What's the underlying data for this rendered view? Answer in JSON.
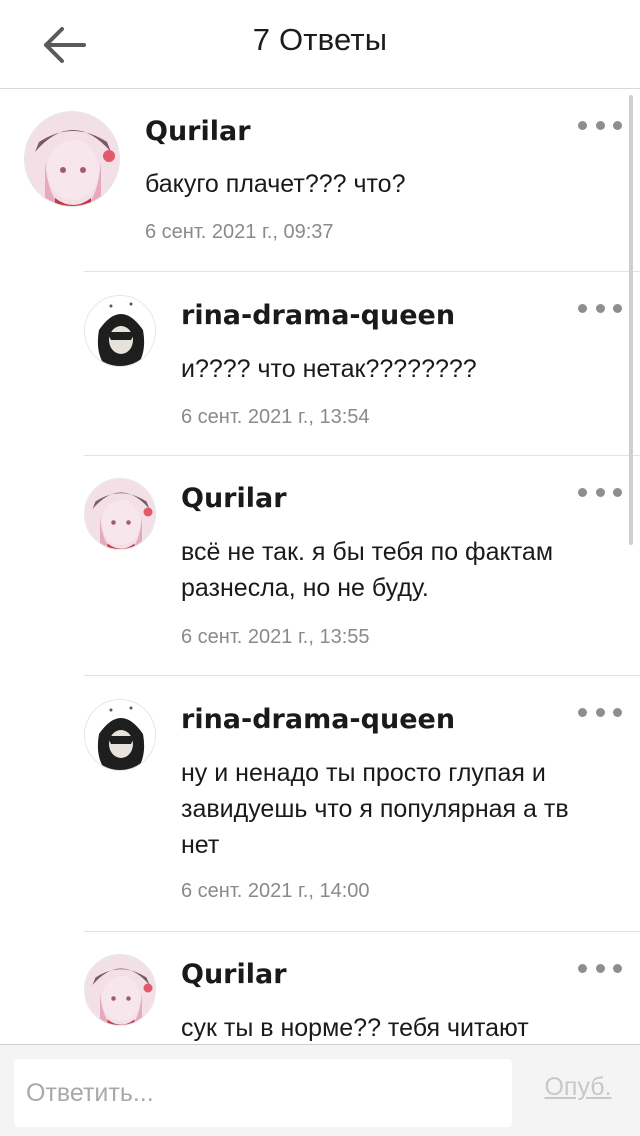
{
  "header": {
    "title": "7 Ответы",
    "back_icon": "arrow-left-icon"
  },
  "comments": [
    {
      "author": "Qurilar",
      "text": "бакуго плачет??? что?",
      "date": "6 сент. 2021 г., 09:37",
      "avatar": "pink-anime-avatar"
    },
    {
      "author": "rina-drama-queen",
      "text": "и???? что нетак????????",
      "date": "6 сент. 2021 г., 13:54",
      "avatar": "dark-anime-avatar"
    },
    {
      "author": "Qurilar",
      "text": "всё не так. я бы тебя по фактам разнесла, но не буду.",
      "date": "6 сент. 2021 г., 13:55",
      "avatar": "pink-anime-avatar"
    },
    {
      "author": "rina-drama-queen",
      "text": "ну и ненадо ты просто глупая и завидуешь что я популярная а тв нет",
      "date": "6 сент. 2021 г., 14:00",
      "avatar": "dark-anime-avatar"
    },
    {
      "author": "Qurilar",
      "text": "сук ты в норме?? тебя читают",
      "date": "",
      "avatar": "pink-anime-avatar"
    }
  ],
  "footer": {
    "reply_placeholder": "Ответить...",
    "publish_label": "Опуб."
  },
  "colors": {
    "text": "#1a1a1a",
    "muted": "#8a8a8a",
    "divider": "#e3e3e3",
    "publish_disabled": "#c8c8c8"
  }
}
